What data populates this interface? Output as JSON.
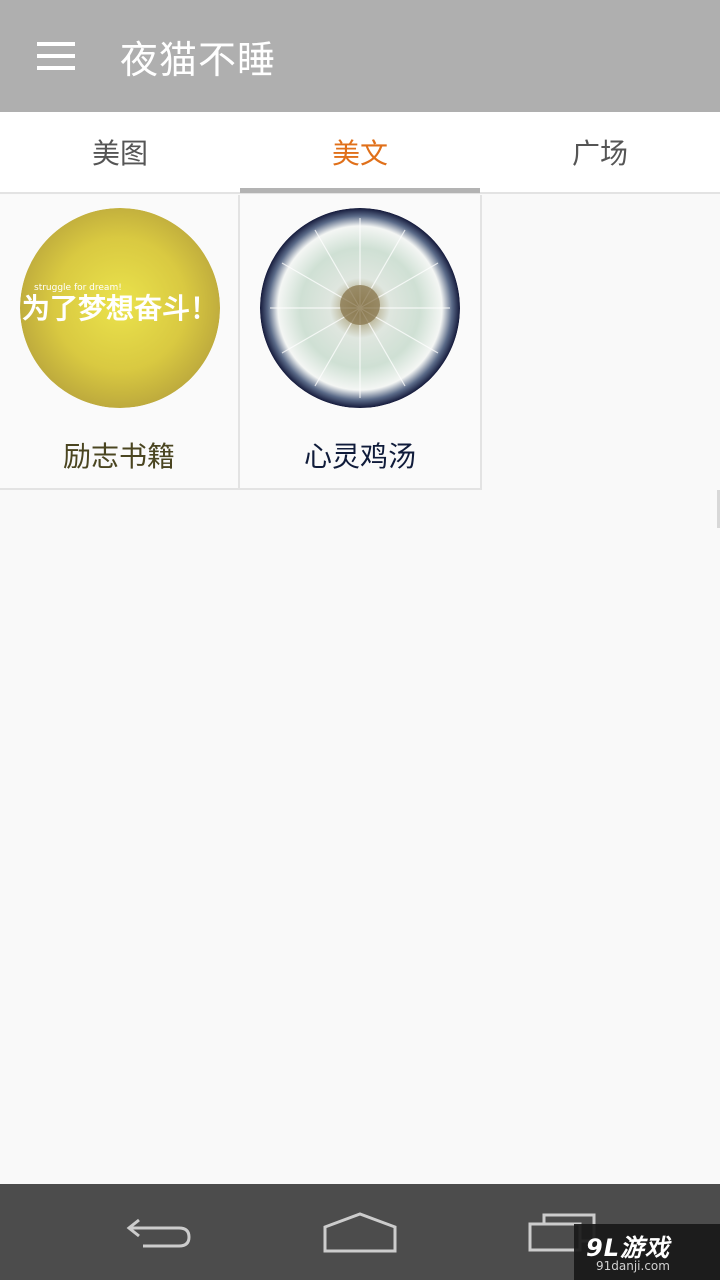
{
  "app": {
    "title": "夜猫不睡"
  },
  "tabs": [
    {
      "label": "美图",
      "active": false
    },
    {
      "label": "美文",
      "active": true
    },
    {
      "label": "广场",
      "active": false
    }
  ],
  "categories": [
    {
      "label": "励志书籍",
      "image_text_small": "struggle for dream!",
      "image_text_large": "为了梦想奋斗！"
    },
    {
      "label": "心灵鸡汤"
    }
  ],
  "watermark": {
    "main": "9L游戏",
    "sub": "91danji.com"
  },
  "colors": {
    "appbar": "#afafaf",
    "tab_active": "#e0701a",
    "tab_inactive": "#555555",
    "indicator": "#b3b3b3",
    "navbar": "#4c4c4c"
  },
  "icons": {
    "menu": "menu-icon",
    "back": "back-icon",
    "home": "home-icon",
    "recent": "recent-apps-icon"
  }
}
